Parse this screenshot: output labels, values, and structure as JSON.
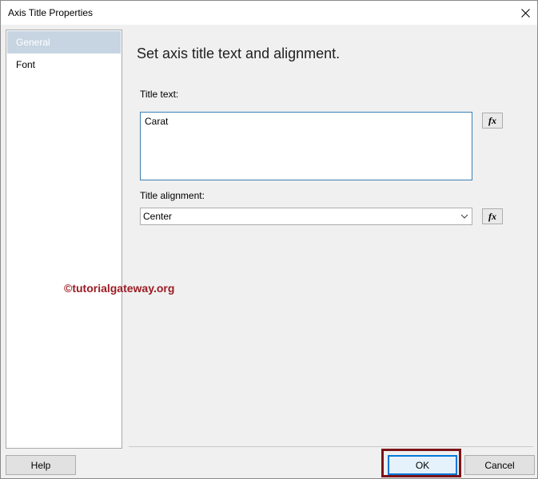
{
  "window": {
    "title": "Axis Title Properties",
    "close_icon": "close-icon"
  },
  "nav": {
    "items": [
      {
        "label": "General",
        "selected": true
      },
      {
        "label": "Font",
        "selected": false
      }
    ]
  },
  "main": {
    "heading": "Set axis title text and alignment.",
    "title_text_label": "Title text:",
    "title_text_value": "Carat",
    "title_alignment_label": "Title alignment:",
    "title_alignment_value": "Center",
    "fx_label": "fx"
  },
  "watermark": "©tutorialgateway.org",
  "footer": {
    "help_label": "Help",
    "ok_label": "OK",
    "cancel_label": "Cancel"
  },
  "colors": {
    "selected_nav": "#c7d5e2",
    "focus_border": "#0078d7",
    "highlight_box": "#7a1419",
    "watermark": "#9b1c24"
  }
}
